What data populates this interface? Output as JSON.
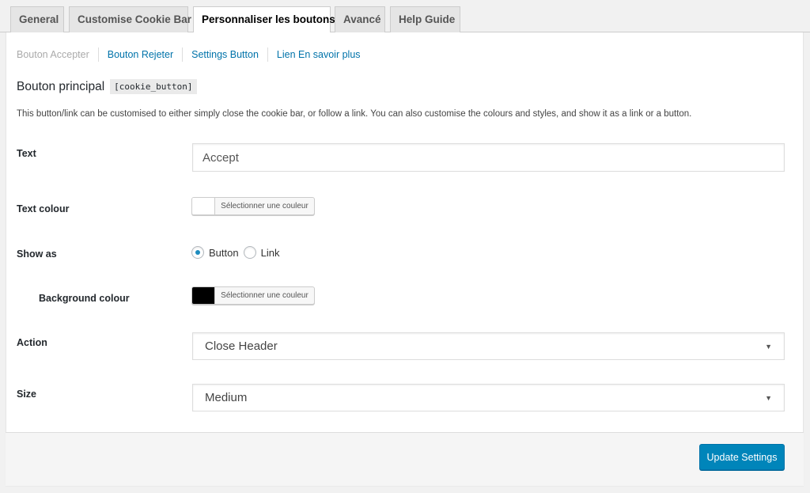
{
  "tabs": [
    {
      "label": "General"
    },
    {
      "label": "Customise Cookie Bar"
    },
    {
      "label": "Personnaliser les boutons",
      "active": true
    },
    {
      "label": "Avancé"
    },
    {
      "label": "Help Guide"
    }
  ],
  "subnav": [
    {
      "label": "Bouton Accepter",
      "current": true
    },
    {
      "label": "Bouton Rejeter"
    },
    {
      "label": "Settings Button"
    },
    {
      "label": "Lien En savoir plus"
    }
  ],
  "section": {
    "title": "Bouton principal",
    "shortcode": "[cookie_button]",
    "description": "This button/link can be customised to either simply close the cookie bar, or follow a link. You can also customise the colours and styles, and show it as a link or a button."
  },
  "fields": {
    "text": {
      "label": "Text",
      "value": "Accept"
    },
    "text_colour": {
      "label": "Text colour",
      "button": "Sélectionner une couleur",
      "swatch": "#ffffff"
    },
    "show_as": {
      "label": "Show as",
      "options": [
        "Button",
        "Link"
      ],
      "selected": "Button"
    },
    "background_colour": {
      "label": "Background colour",
      "button": "Sélectionner une couleur",
      "swatch": "#000000"
    },
    "action": {
      "label": "Action",
      "value": "Close Header"
    },
    "size": {
      "label": "Size",
      "value": "Medium"
    }
  },
  "footer": {
    "update_label": "Update Settings"
  },
  "colors": {
    "accent": "#0085ba",
    "link": "#0073aa"
  }
}
